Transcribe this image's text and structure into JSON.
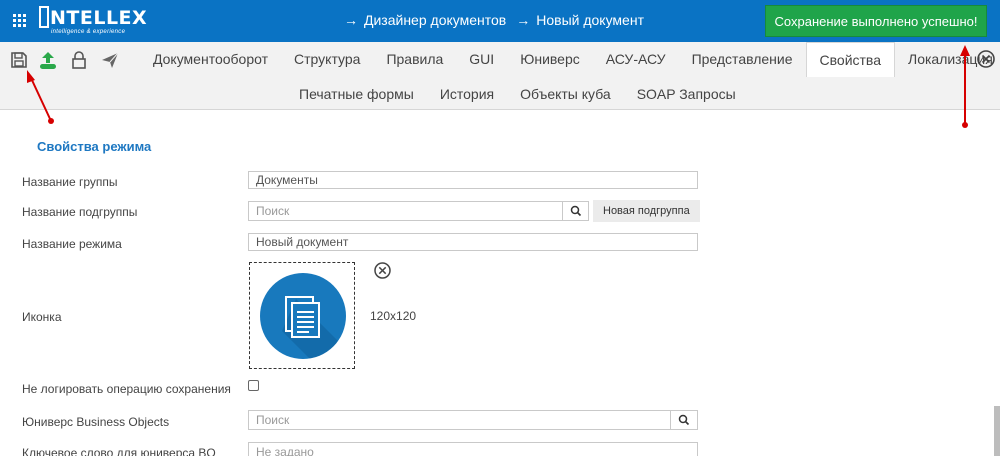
{
  "header": {
    "logo_text": "NTELLEX",
    "logo_tagline": "intelligence & experience",
    "breadcrumb": [
      "Дизайнер документов",
      "Новый документ"
    ],
    "breadcrumb_separator": "→",
    "toast": "Сохранение выполнено успешно!"
  },
  "toolbar": {
    "icons": [
      "save-icon",
      "upload-icon",
      "lock-icon",
      "send-icon"
    ]
  },
  "tabs": [
    {
      "label": "Документооборот",
      "active": false
    },
    {
      "label": "Структура",
      "active": false
    },
    {
      "label": "Правила",
      "active": false
    },
    {
      "label": "GUI",
      "active": false
    },
    {
      "label": "Юниверс",
      "active": false
    },
    {
      "label": "АСУ-АСУ",
      "active": false
    },
    {
      "label": "Представление",
      "active": false
    },
    {
      "label": "Свойства",
      "active": true
    },
    {
      "label": "Локализация",
      "active": false
    }
  ],
  "subtabs": [
    {
      "label": "Печатные формы"
    },
    {
      "label": "История"
    },
    {
      "label": "Объекты куба"
    },
    {
      "label": "SOAP Запросы"
    }
  ],
  "form": {
    "section_title": "Свойства режима",
    "group_label": "Название группы",
    "group_value": "Документы",
    "subgroup_label": "Название подгруппы",
    "subgroup_placeholder": "Поиск",
    "new_subgroup_button": "Новая подгруппа",
    "mode_label": "Название режима",
    "mode_value": "Новый документ",
    "icon_label": "Иконка",
    "icon_size": "120x120",
    "no_log_label": "Не логировать операцию сохранения",
    "no_log_checked": false,
    "universe_label": "Юниверс Business Objects",
    "universe_placeholder": "Поиск",
    "keyword_label": "Ключевое слово для юниверса BO",
    "keyword_placeholder": "Не задано"
  },
  "colors": {
    "header_bg": "#0a73c4",
    "toast_bg": "#1fa44a",
    "accent": "#1e78c2",
    "annotation": "#d60000",
    "upload_icon": "#2aa84a"
  }
}
